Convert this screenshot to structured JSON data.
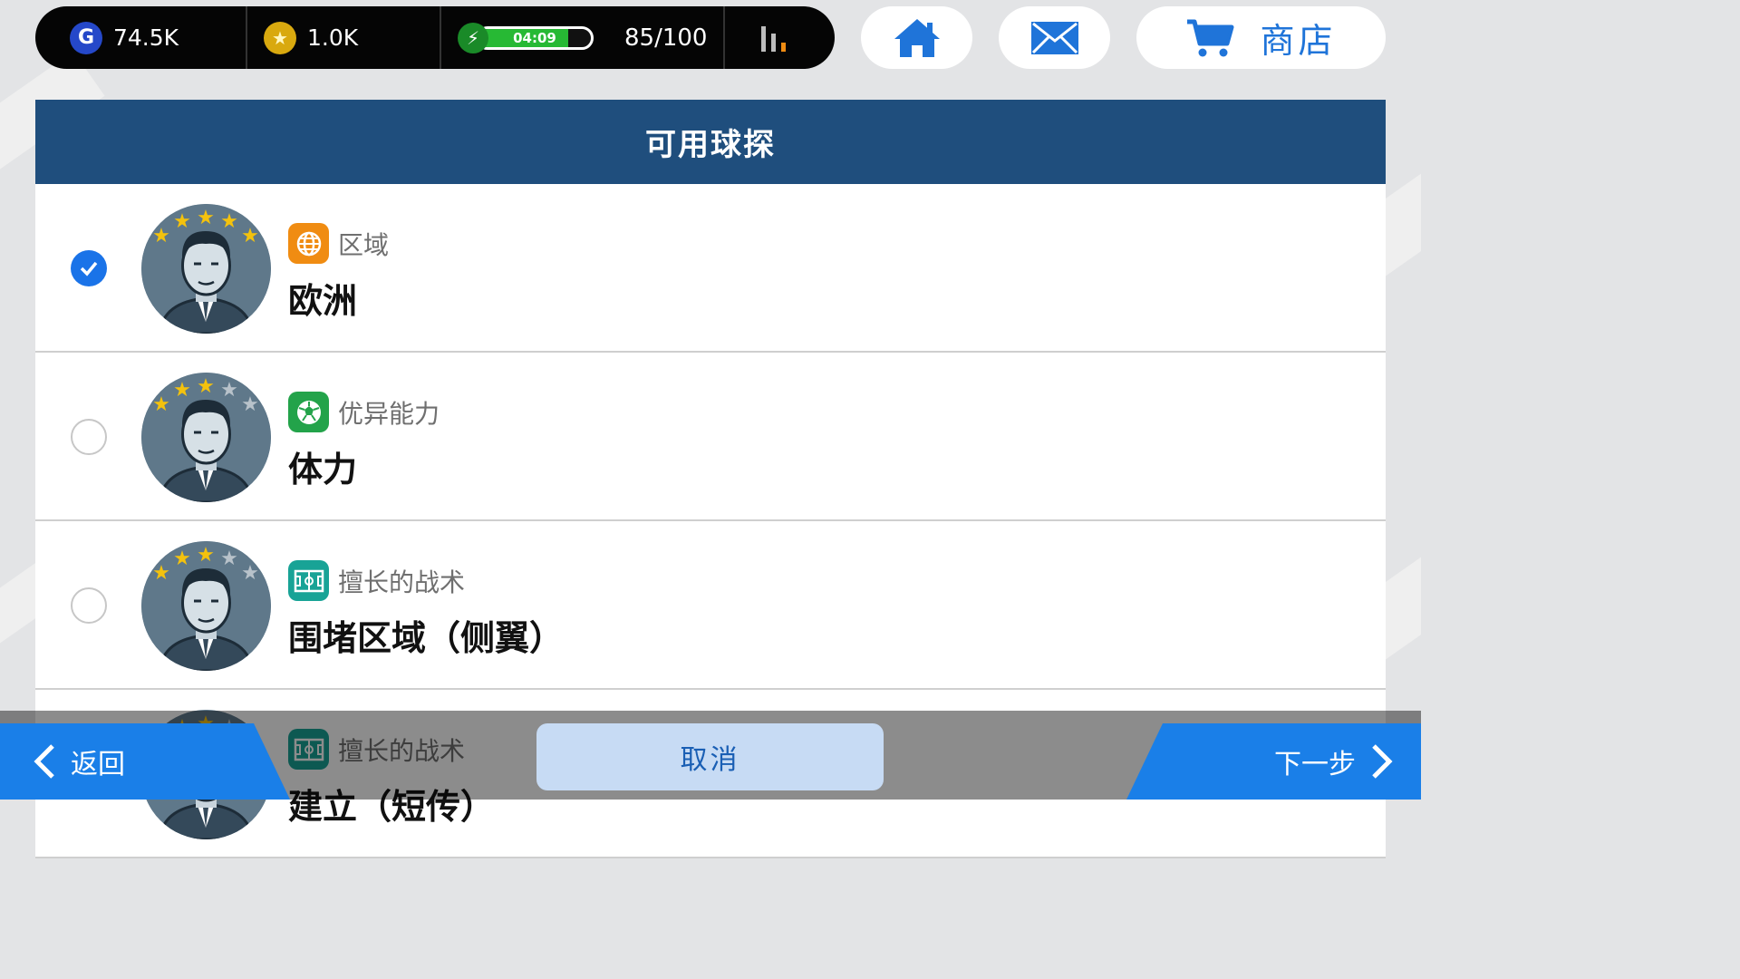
{
  "top_bar": {
    "gp_icon": "gp-icon",
    "gp_value": "74.5K",
    "coin_icon": "coin-icon",
    "coin_value": "1.0K",
    "energy_icon": "lightning-icon",
    "energy_timer": "04:09",
    "energy_fill_fraction": 0.8,
    "energy_count": "85/100",
    "signal_icon": "signal-bars-icon",
    "home_icon": "home-icon",
    "mail_icon": "mail-icon",
    "cart_icon": "cart-icon",
    "shop_label": "商店"
  },
  "panel": {
    "title": "可用球探",
    "scouts": [
      {
        "selected": true,
        "stars_filled": 5,
        "stars_total": 5,
        "category_icon": "globe-icon",
        "category_color": "#f08c12",
        "category": "区域",
        "value": "欧洲"
      },
      {
        "selected": false,
        "stars_filled": 3,
        "stars_total": 5,
        "category_icon": "soccer-ball-icon",
        "category_color": "#23a34a",
        "category": "优异能力",
        "value": "体力"
      },
      {
        "selected": false,
        "stars_filled": 3,
        "stars_total": 5,
        "category_icon": "tactics-board-icon",
        "category_color": "#18a396",
        "category": "擅长的战术",
        "value": "围堵区域（侧翼）"
      },
      {
        "selected": false,
        "stars_filled": 3,
        "stars_total": 5,
        "category_icon": "tactics-board-icon",
        "category_color": "#18a396",
        "category": "擅长的战术",
        "value": "建立（短传）"
      }
    ]
  },
  "bottom_bar": {
    "back_label": "返回",
    "cancel_label": "取消",
    "next_label": "下一步"
  },
  "colors": {
    "header": "#1f4e7d",
    "accent": "#1a7fe8",
    "check": "#1a73e8",
    "star": "#f4c20d"
  }
}
